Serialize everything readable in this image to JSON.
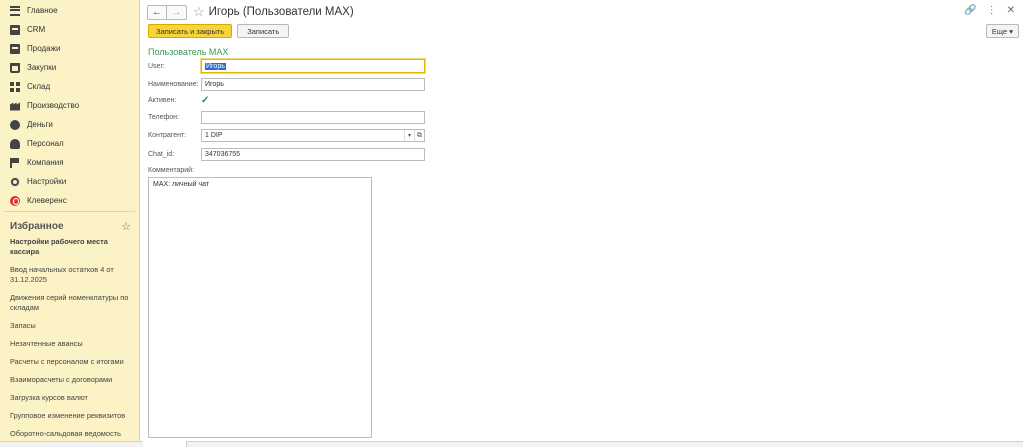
{
  "sidebar": {
    "menu": [
      {
        "label": "Главное",
        "icon": "menu-lines-icon"
      },
      {
        "label": "CRM",
        "icon": "crm-box-icon"
      },
      {
        "label": "Продажи",
        "icon": "briefcase-icon"
      },
      {
        "label": "Закупки",
        "icon": "cart-icon"
      },
      {
        "label": "Склад",
        "icon": "warehouse-grid-icon"
      },
      {
        "label": "Производство",
        "icon": "factory-icon"
      },
      {
        "label": "Деньги",
        "icon": "coin-icon"
      },
      {
        "label": "Персонал",
        "icon": "person-icon"
      },
      {
        "label": "Компания",
        "icon": "flag-icon"
      },
      {
        "label": "Настройки",
        "icon": "gear-icon"
      },
      {
        "label": "Клеверенс",
        "icon": "cleverence-logo-icon"
      }
    ],
    "favorites_title": "Избранное",
    "favorites": [
      {
        "label": "Настройки рабочего места кассира",
        "bold": true
      },
      {
        "label": "Ввод начальных остатков 4 от 31.12.2025",
        "bold": false
      },
      {
        "label": "Движения серий номенклатуры по складам",
        "bold": false
      },
      {
        "label": "Запасы",
        "bold": false
      },
      {
        "label": "Незачтенные авансы",
        "bold": false
      },
      {
        "label": "Расчеты с персоналом с итогами",
        "bold": false
      },
      {
        "label": "Взаиморасчеты с договорами",
        "bold": false
      },
      {
        "label": "Загрузка курсов валют",
        "bold": false
      },
      {
        "label": "Групповое изменение реквизитов",
        "bold": false
      },
      {
        "label": "Оборотно-сальдовая ведомость",
        "bold": false
      }
    ]
  },
  "header": {
    "back": "←",
    "forward": "→",
    "star": "☆",
    "title": "Игорь (Пользователи MAX)",
    "link_icon": "🔗",
    "more_icon": "⋮",
    "close_icon": "✕"
  },
  "toolbar": {
    "save_close": "Записать и закрыть",
    "save": "Записать",
    "more": "Еще"
  },
  "form": {
    "group_title": "Пользователь MAX",
    "user_label": "User:",
    "user_value": "Игорь",
    "name_label": "Наименование:",
    "name_value": "Игорь",
    "active_label": "Активен:",
    "active_check": "✓",
    "phone_label": "Телефон:",
    "phone_value": "",
    "counterparty_label": "Контрагент:",
    "counterparty_value": "1 DIP",
    "chat_label": "Chat_id:",
    "chat_value": "347036755",
    "comment_label": "Комментарий:",
    "comment_value": "MAX: личный чат"
  },
  "colors": {
    "sidebar_bg": "#fbf3c6",
    "primary_button": "#f8d33a",
    "group_title": "#3a9a55",
    "selection": "#3269c4"
  }
}
